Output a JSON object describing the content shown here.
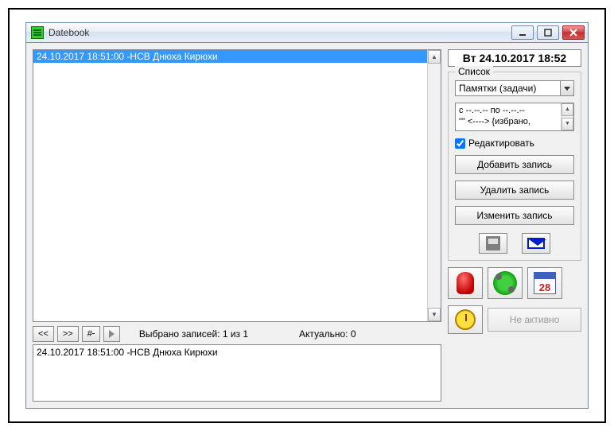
{
  "window": {
    "title": "Datebook"
  },
  "list": {
    "selected_entry": "24.10.2017  18:51:00  -НСВ  Днюха Кирюхи"
  },
  "nav": {
    "prev": "<<",
    "next": ">>",
    "hash": "#",
    "selection_count": "Выбрано записей: 1 из 1",
    "actual": "Актуально: 0"
  },
  "detail": {
    "text": "24.10.2017  18:51:00  -НСВ  Днюха Кирюхи"
  },
  "header": {
    "datetime": "Вт  24.10.2017  18:52"
  },
  "group": {
    "title": "Список",
    "filter_selected": "Памятки (задачи)",
    "filter_line1": "с --.--.--   по --.--.--",
    "filter_line2": "\"\" <----> {избрано,",
    "edit_label": "Редактировать",
    "add_btn": "Добавить запись",
    "delete_btn": "Удалить запись",
    "edit_btn": "Изменить запись"
  },
  "icons": {
    "cal_day": "28"
  },
  "bottom": {
    "inactive": "Не активно"
  }
}
